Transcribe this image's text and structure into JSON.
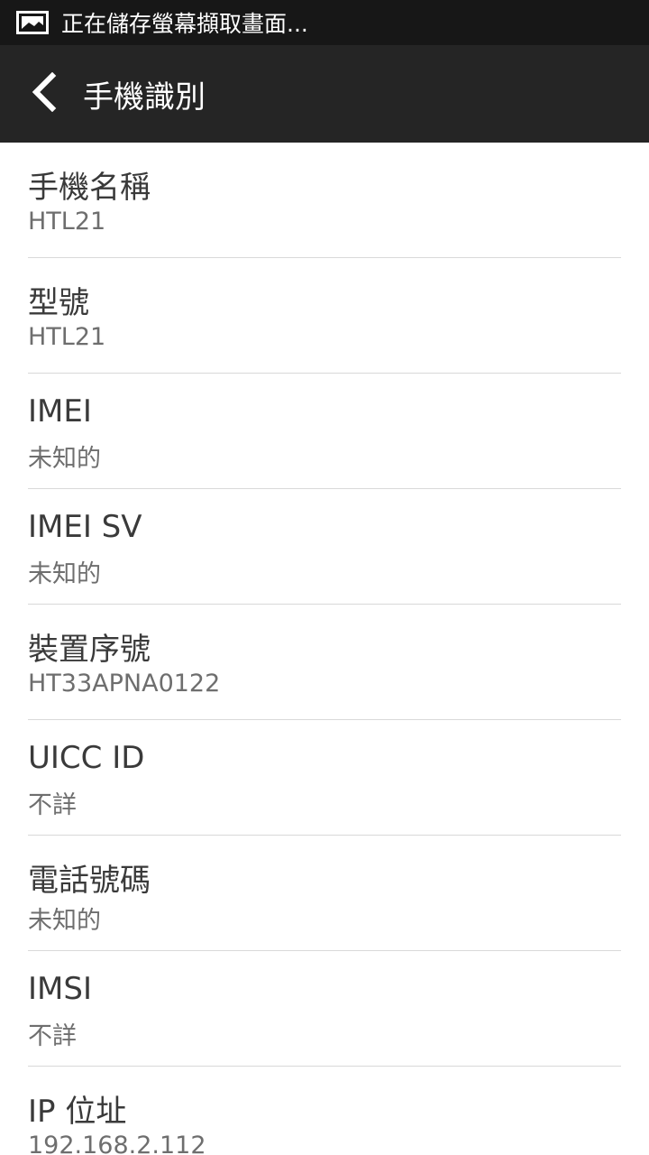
{
  "status_bar": {
    "notification_icon": "screenshot-icon",
    "notification_text": "正在儲存螢幕擷取畫面..."
  },
  "app_bar": {
    "back_icon": "chevron-left-icon",
    "title": "手機識別"
  },
  "colors": {
    "status_bar_bg": "#171717",
    "app_bar_bg": "#252525",
    "divider": "#d9d9d9",
    "label": "#3a3a3a",
    "value": "#6e6e6e"
  },
  "items": [
    {
      "label": "手機名稱",
      "value": "HTL21"
    },
    {
      "label": "型號",
      "value": "HTL21"
    },
    {
      "label": "IMEI",
      "value": "未知的"
    },
    {
      "label": "IMEI SV",
      "value": "未知的"
    },
    {
      "label": "裝置序號",
      "value": "HT33APNA0122"
    },
    {
      "label": "UICC ID",
      "value": "不詳"
    },
    {
      "label": "電話號碼",
      "value": "未知的"
    },
    {
      "label": "IMSI",
      "value": "不詳"
    },
    {
      "label": "IP 位址",
      "value": "192.168.2.112"
    }
  ]
}
